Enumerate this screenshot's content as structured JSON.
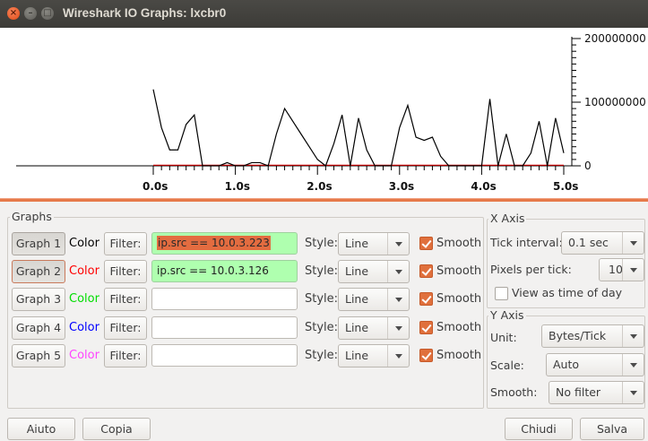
{
  "window": {
    "title": "Wireshark IO Graphs: lxcbr0",
    "close_glyph": "×",
    "minimize_glyph": "–",
    "maximize_glyph": "□"
  },
  "chart_data": {
    "type": "line",
    "x_ticks": [
      "0.0s",
      "1.0s",
      "2.0s",
      "3.0s",
      "4.0s",
      "5.0s"
    ],
    "y_ticks": [
      "0",
      "100000000",
      "200000000"
    ],
    "xlim": [
      0,
      5.0
    ],
    "ylim": [
      0,
      200000000
    ],
    "series": [
      {
        "color": "#000000",
        "x": [
          0.0,
          0.1,
          0.2,
          0.3,
          0.4,
          0.5,
          0.6,
          0.7,
          0.8,
          0.9,
          1.0,
          1.1,
          1.2,
          1.3,
          1.4,
          1.5,
          1.6,
          1.7,
          1.8,
          1.9,
          2.0,
          2.1,
          2.2,
          2.3,
          2.4,
          2.5,
          2.6,
          2.7,
          2.8,
          2.9,
          3.0,
          3.1,
          3.2,
          3.3,
          3.4,
          3.5,
          3.6,
          3.7,
          3.8,
          3.9,
          4.0,
          4.1,
          4.2,
          4.3,
          4.4,
          4.5,
          4.6,
          4.7,
          4.8,
          4.9,
          5.0
        ],
        "y": [
          120000000,
          60000000,
          25000000,
          25000000,
          65000000,
          80000000,
          0,
          0,
          0,
          5000000,
          0,
          0,
          5000000,
          5000000,
          0,
          50000000,
          90000000,
          70000000,
          50000000,
          30000000,
          10000000,
          0,
          35000000,
          80000000,
          0,
          75000000,
          25000000,
          0,
          0,
          0,
          60000000,
          95000000,
          45000000,
          40000000,
          45000000,
          15000000,
          0,
          0,
          0,
          0,
          0,
          105000000,
          0,
          50000000,
          0,
          0,
          20000000,
          70000000,
          0,
          75000000,
          20000000
        ]
      },
      {
        "color": "#cc0000",
        "x": [
          0.0,
          0.1,
          0.2,
          0.3,
          0.4,
          0.5,
          0.6,
          0.7,
          0.8,
          0.9,
          1.0,
          1.1,
          1.2,
          1.3,
          1.4,
          1.5,
          1.6,
          1.7,
          1.8,
          1.9,
          2.0,
          2.1,
          2.2,
          2.3,
          2.4,
          2.5,
          2.6,
          2.7,
          2.8,
          2.9,
          3.0,
          3.1,
          3.2,
          3.3,
          3.4,
          3.5,
          3.6,
          3.7,
          3.8,
          3.9,
          4.0,
          4.1,
          4.2,
          4.3,
          4.4,
          4.5,
          4.6,
          4.7,
          4.8,
          4.9,
          5.0
        ],
        "y": [
          1000000,
          1000000,
          1000000,
          1000000,
          1000000,
          1000000,
          1000000,
          1000000,
          1000000,
          1000000,
          1000000,
          1000000,
          1000000,
          1000000,
          1000000,
          1000000,
          1000000,
          1000000,
          1000000,
          1000000,
          1000000,
          1000000,
          1000000,
          1000000,
          1000000,
          1000000,
          1000000,
          1000000,
          1000000,
          1000000,
          1000000,
          1000000,
          1000000,
          1000000,
          1000000,
          1000000,
          1000000,
          1000000,
          1000000,
          1000000,
          1000000,
          1000000,
          1000000,
          1000000,
          1000000,
          1000000,
          1000000,
          1000000,
          1000000,
          1000000,
          1000000
        ]
      }
    ]
  },
  "graphs_frame": {
    "label": "Graphs",
    "color_label": "Color",
    "filter_label": "Filter:",
    "style_label": "Style:",
    "smooth_label": "Smooth",
    "rows": [
      {
        "button": "Graph 1",
        "color": "#000000",
        "filter": "ip.src == 10.0.3.223",
        "style": "Line",
        "smooth": true
      },
      {
        "button": "Graph 2",
        "color": "#ff0000",
        "filter": "ip.src == 10.0.3.126",
        "style": "Line",
        "smooth": true
      },
      {
        "button": "Graph 3",
        "color": "#00dd00",
        "filter": "",
        "style": "Line",
        "smooth": true
      },
      {
        "button": "Graph 4",
        "color": "#0000ff",
        "filter": "",
        "style": "Line",
        "smooth": true
      },
      {
        "button": "Graph 5",
        "color": "#ff44ff",
        "filter": "",
        "style": "Line",
        "smooth": true
      }
    ]
  },
  "x_axis": {
    "label": "X Axis",
    "tick_interval_label": "Tick interval:",
    "tick_interval_value": "0.1 sec",
    "pixels_per_tick_label": "Pixels per tick:",
    "pixels_per_tick_value": "10",
    "view_time_of_day_label": "View as time of day",
    "view_time_of_day": false
  },
  "y_axis": {
    "label": "Y Axis",
    "unit_label": "Unit:",
    "unit_value": "Bytes/Tick",
    "scale_label": "Scale:",
    "scale_value": "Auto",
    "smooth_label": "Smooth:",
    "smooth_value": "No filter"
  },
  "buttons": {
    "help": "Aiuto",
    "copy": "Copia",
    "close": "Chiudi",
    "save": "Salva"
  }
}
